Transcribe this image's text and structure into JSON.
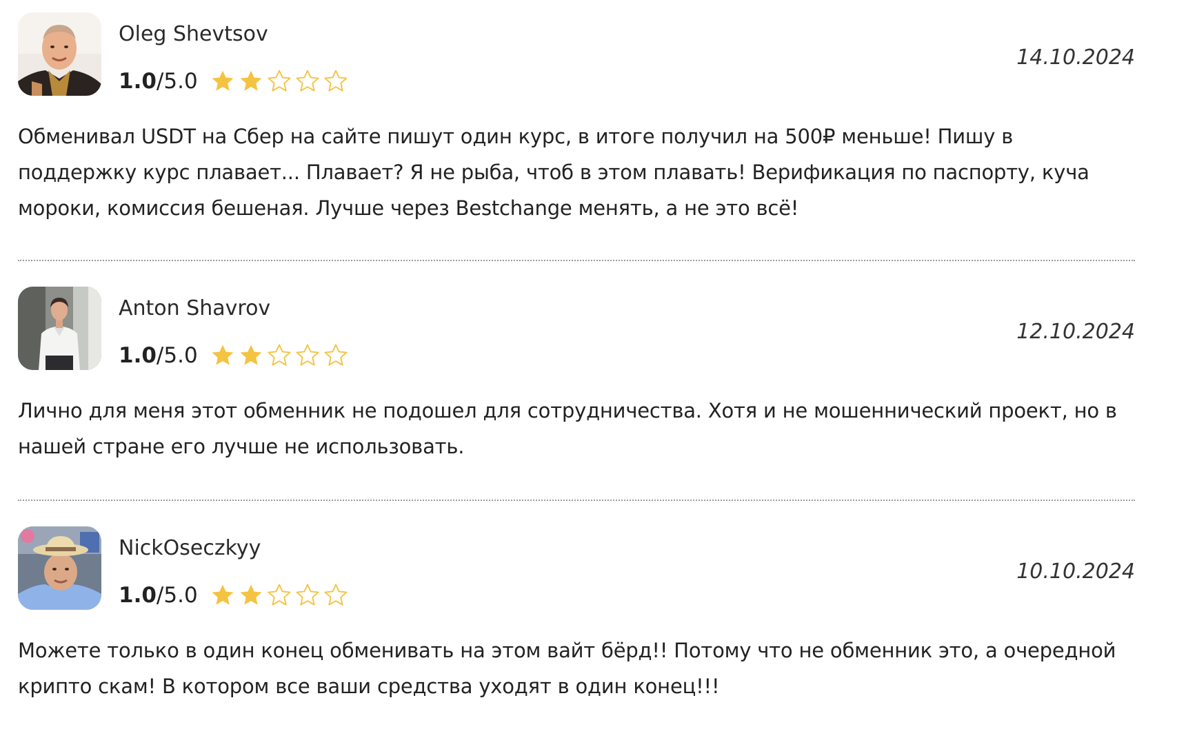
{
  "reviews": [
    {
      "author": "Oleg Shevtsov",
      "score": "1.0",
      "max_score": "/5.0",
      "stars_filled": 2,
      "stars_total": 5,
      "date": "14.10.2024",
      "text": "Обменивал USDT на Сбер на сайте пишут один курс, в итоге получил на 500₽ меньше! Пишу в поддержку курс плавает... Плавает? Я не рыба, чтоб в этом плавать! Верификация по паспорту, куча мороки, комиссия бешеная. Лучше через Bestchange менять, а не это всё!",
      "avatar_icon": "avatar-photo-man-bald"
    },
    {
      "author": "Anton Shavrov",
      "score": "1.0",
      "max_score": "/5.0",
      "stars_filled": 2,
      "stars_total": 5,
      "date": "12.10.2024",
      "text": "Лично для меня этот обменник не подошел для сотрудничества. Хотя и не мошеннический проект, но в нашей стране его лучше не использовать.",
      "avatar_icon": "avatar-photo-man-white-shirt"
    },
    {
      "author": "NickOseczkyy",
      "score": "1.0",
      "max_score": "/5.0",
      "stars_filled": 2,
      "stars_total": 5,
      "date": "10.10.2024",
      "text": "Можете только в один конец обменивать на этом вайт бёрд!! Потому что не обменник это, а очередной крипто скам! В котором все ваши средства уходят в один конец!!!",
      "avatar_icon": "avatar-photo-man-straw-hat"
    }
  ],
  "colors": {
    "star_fill": "#F5C342",
    "star_outline": "#F5C342",
    "divider": "#9a9a9a",
    "text": "#222222"
  }
}
